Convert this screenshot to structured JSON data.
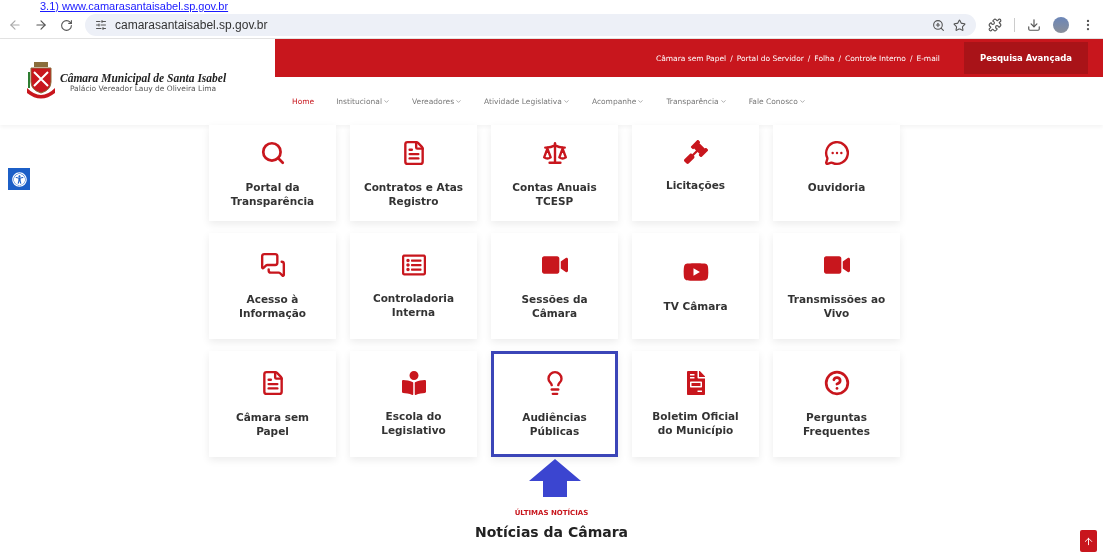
{
  "caption": "3.1) www.camarasantaisabel.sp.gov.br",
  "browser": {
    "url": "camarasantaisabel.sp.gov.br"
  },
  "header": {
    "logo_title": "Câmara Municipal de Santa Isabel",
    "logo_subtitle": "Palácio Vereador Lauy de Oliveira Lima",
    "top_links": [
      "Câmara sem Papel",
      "Portal do Servidor",
      "Folha",
      "Controle Interno",
      "E-mail"
    ],
    "link_separator": "/",
    "search_button": "Pesquisa Avançada",
    "nav": [
      {
        "label": "Home",
        "selected": true,
        "dropdown": false
      },
      {
        "label": "Institucional",
        "selected": false,
        "dropdown": true
      },
      {
        "label": "Vereadores",
        "selected": false,
        "dropdown": true
      },
      {
        "label": "Atividade Legislativa",
        "selected": false,
        "dropdown": true
      },
      {
        "label": "Acompanhe",
        "selected": false,
        "dropdown": true
      },
      {
        "label": "Transparência",
        "selected": false,
        "dropdown": true
      },
      {
        "label": "Fale Conosco",
        "selected": false,
        "dropdown": true
      }
    ]
  },
  "tiles": [
    {
      "label": "Portal da Transparência",
      "kind": "search",
      "highlighted": false
    },
    {
      "label": "Contratos e Atas Registro",
      "kind": "document",
      "highlighted": false
    },
    {
      "label": "Contas Anuais TCESP",
      "kind": "scale",
      "highlighted": false
    },
    {
      "label": "Licitações",
      "kind": "gavel",
      "highlighted": false
    },
    {
      "label": "Ouvidoria",
      "kind": "chat",
      "highlighted": false
    },
    {
      "label": "Acesso à Informação",
      "kind": "chats",
      "highlighted": false
    },
    {
      "label": "Controladoria Interna",
      "kind": "list",
      "highlighted": false
    },
    {
      "label": "Sessões da Câmara",
      "kind": "video",
      "highlighted": false
    },
    {
      "label": "TV Câmara",
      "kind": "play",
      "highlighted": false
    },
    {
      "label": "Transmissões ao Vivo",
      "kind": "video",
      "highlighted": false
    },
    {
      "label": "Câmara sem Papel",
      "kind": "document",
      "highlighted": false
    },
    {
      "label": "Escola do Legislativo",
      "kind": "reader",
      "highlighted": false
    },
    {
      "label": "Audiências Públicas",
      "kind": "bulb",
      "highlighted": true
    },
    {
      "label": "Boletim Oficial do Município",
      "kind": "filled-doc",
      "highlighted": false
    },
    {
      "label": "Perguntas Frequentes",
      "kind": "question",
      "highlighted": false
    }
  ],
  "news": {
    "eyebrow": "ÚLTIMAS NOTÍCIAS",
    "title": "Notícias da Câmara"
  }
}
